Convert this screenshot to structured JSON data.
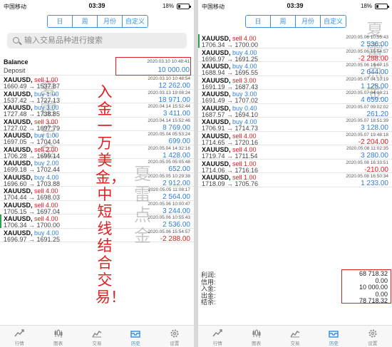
{
  "status": {
    "carrier": "中国移动",
    "time": "03:39",
    "battery": "18%",
    "battery_level": 0.18
  },
  "segments": {
    "items": [
      "日",
      "周",
      "月份",
      "自定义"
    ],
    "active_index": 3
  },
  "search": {
    "placeholder": "输入交易品种进行搜索"
  },
  "balance": {
    "title": "Balance",
    "type": "Deposit",
    "time": "2020.03.10 10:48:41",
    "amount": "10 000.00"
  },
  "left_trades": [
    {
      "symbol": "XAUUSD,",
      "side": "sell 1.00",
      "dir": "sell",
      "prices": "1660.49 → 1537.87",
      "time": "2020.03.10 10:48:54",
      "profit": "12 262.00",
      "neg": false,
      "marked": false
    },
    {
      "symbol": "XAUUSD,",
      "side": "buy 1.00",
      "dir": "buy",
      "prices": "1537.42 → 1727.13",
      "time": "2020.03.13 19:08:24",
      "profit": "18 971.00",
      "neg": false,
      "marked": false
    },
    {
      "symbol": "XAUUSD,",
      "side": "buy 3.00",
      "dir": "buy",
      "prices": "1727.48 → 1738.85",
      "time": "2020.04.14 15:52:44",
      "profit": "3 411.00",
      "neg": false,
      "marked": false
    },
    {
      "symbol": "XAUUSD,",
      "side": "sell 3.00",
      "dir": "sell",
      "prices": "1727.02 → 1697.79",
      "time": "2020.04.14 15:52:46",
      "profit": "8 769.00",
      "neg": false,
      "marked": false
    },
    {
      "symbol": "XAUUSD,",
      "side": "buy 1.00",
      "dir": "buy",
      "prices": "1697.05 → 1704.04",
      "time": "2020.05.04 05:53:24",
      "profit": "699.00",
      "neg": false,
      "marked": false
    },
    {
      "symbol": "XAUUSD,",
      "side": "sell 2.00",
      "dir": "sell",
      "prices": "1706.28 → 1699.14",
      "time": "2020.05.04 14:32:16",
      "profit": "1 428.00",
      "neg": false,
      "marked": false
    },
    {
      "symbol": "XAUUSD,",
      "side": "buy 2.00",
      "dir": "buy",
      "prices": "1699.18 → 1702.44",
      "time": "2020.05.05 05:05:48",
      "profit": "652.00",
      "neg": false,
      "marked": false
    },
    {
      "symbol": "XAUUSD,",
      "side": "buy 4.00",
      "dir": "buy",
      "prices": "1696.60 → 1703.88",
      "time": "2020.05.05 10:29:38",
      "profit": "2 912.00",
      "neg": false,
      "marked": false
    },
    {
      "symbol": "XAUUSD,",
      "side": "sell 4.00",
      "dir": "sell",
      "prices": "1704.44 → 1698.03",
      "time": "2020.05.05 11:08:17",
      "profit": "2 564.00",
      "neg": false,
      "marked": false
    },
    {
      "symbol": "XAUUSD,",
      "side": "sell 4.00",
      "dir": "sell",
      "prices": "1705.15 → 1697.04",
      "time": "2020.05.06 10:00:47",
      "profit": "3 244.00",
      "neg": false,
      "marked": false
    },
    {
      "symbol": "XAUUSD,",
      "side": "sell 4.00",
      "dir": "sell",
      "prices": "1706.34 → 1700.00",
      "time": "2020.05.06 10:55:43",
      "profit": "2 536.00",
      "neg": false,
      "marked": true
    },
    {
      "symbol": "XAUUSD,",
      "side": "buy 4.00",
      "dir": "buy",
      "prices": "1696.97 → 1691.25",
      "time": "2020.05.06 15:54:57",
      "profit": "-2 288.00",
      "neg": true,
      "marked": false
    }
  ],
  "right_trades": [
    {
      "symbol": "XAUUSD,",
      "side": "sell 4.00",
      "dir": "sell",
      "prices": "1706.34 → 1700.00",
      "time": "2020.05.06 10:55:43",
      "profit": "2 536.00",
      "neg": false,
      "marked": true
    },
    {
      "symbol": "XAUUSD,",
      "side": "buy 4.00",
      "dir": "buy",
      "prices": "1696.97 → 1691.25",
      "time": "2020.05.06 15:54:57",
      "profit": "-2 288.00",
      "neg": true,
      "marked": false
    },
    {
      "symbol": "XAUUSD,",
      "side": "buy 4.00",
      "dir": "buy",
      "prices": "1688.94 → 1695.55",
      "time": "2020.05.06 16:07:15",
      "profit": "2 644.00",
      "neg": false,
      "marked": false
    },
    {
      "symbol": "XAUUSD,",
      "side": "sell 3.00",
      "dir": "sell",
      "prices": "1691.19 → 1687.43",
      "time": "2020.05.07 04:10:19",
      "profit": "1 128.00",
      "neg": false,
      "marked": false
    },
    {
      "symbol": "XAUUSD,",
      "side": "buy 3.00",
      "dir": "buy",
      "prices": "1691.49 → 1707.02",
      "time": "2020.05.07 04:10:21",
      "profit": "4 659.00",
      "neg": false,
      "marked": false
    },
    {
      "symbol": "XAUUSD,",
      "side": "buy 0.40",
      "dir": "buy",
      "prices": "1687.57 → 1694.10",
      "time": "2020.05.07 09:02:02",
      "profit": "261.20",
      "neg": false,
      "marked": false
    },
    {
      "symbol": "XAUUSD,",
      "side": "buy 4.00",
      "dir": "buy",
      "prices": "1706.91 → 1714.73",
      "time": "2020.05.07 18:51:39",
      "profit": "3 128.00",
      "neg": false,
      "marked": false
    },
    {
      "symbol": "XAUUSD,",
      "side": "sell 4.00",
      "dir": "sell",
      "prices": "1714.65 → 1720.16",
      "time": "2020.05.07 19:48:18",
      "profit": "-2 204.00",
      "neg": true,
      "marked": false
    },
    {
      "symbol": "XAUUSD,",
      "side": "sell 4.00",
      "dir": "sell",
      "prices": "1719.74 → 1711.54",
      "time": "2020.05.08 11:02:35",
      "profit": "3 280.00",
      "neg": false,
      "marked": false
    },
    {
      "symbol": "XAUUSD,",
      "side": "sell 1.00",
      "dir": "sell",
      "prices": "1714.06 → 1716.16",
      "time": "2020.05.08 16:33:51",
      "profit": "-210.00",
      "neg": true,
      "marked": false
    },
    {
      "symbol": "XAUUSD,",
      "side": "sell 1.00",
      "dir": "sell",
      "prices": "1718.09 → 1705.76",
      "time": "2020.05.08 16:50:34",
      "profit": "1 233.00",
      "neg": false,
      "marked": false
    }
  ],
  "summary": [
    {
      "label": "利润:",
      "value": "68 718.32"
    },
    {
      "label": "信用:",
      "value": "0.00"
    },
    {
      "label": "入金:",
      "value": "10 000.00"
    },
    {
      "label": "出金:",
      "value": "0.00"
    },
    {
      "label": "结余:",
      "value": "78 718.32"
    }
  ],
  "tabs": [
    {
      "label": "行情",
      "icon": "trend-icon"
    },
    {
      "label": "图表",
      "icon": "candles-icon"
    },
    {
      "label": "交易",
      "icon": "trade-icon"
    },
    {
      "label": "历史",
      "icon": "history-icon"
    },
    {
      "label": "设置",
      "icon": "gear-icon"
    }
  ],
  "active_tab": 3,
  "annotation": {
    "text": "入金一万美金，中短线结合交易！"
  },
  "watermark": {
    "text": "夏雷点金"
  },
  "colors": {
    "accent": "#3b8fe0",
    "sell": "#e02020",
    "buy": "#2f7fd6",
    "highlight_box": "#e02020"
  }
}
